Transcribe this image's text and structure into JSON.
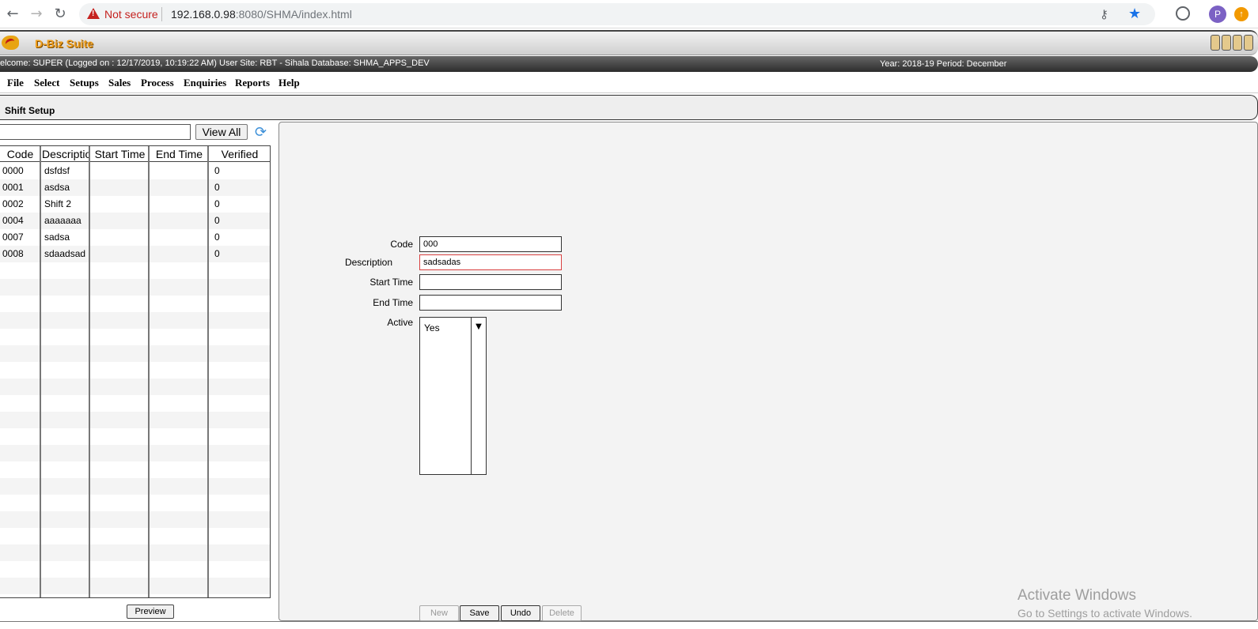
{
  "browser": {
    "security_label": "Not secure",
    "url_host": "192.168.0.98",
    "url_rest": ":8080/SHMA/index.html",
    "profile_initial": "P"
  },
  "app": {
    "logo_text": "D-Biz Suite",
    "welcome_text": "elcome: SUPER (Logged on : 12/17/2019, 10:19:22 AM) User Site: RBT - Sihala Database: SHMA_APPS_DEV",
    "period_text": "Year: 2018-19 Period: December"
  },
  "menu": [
    "File",
    "Select",
    "Setups",
    "Sales",
    "Process",
    "Enquiries",
    "Reports",
    "Help"
  ],
  "page": {
    "title": "Shift Setup"
  },
  "list": {
    "search_value": "",
    "view_all_label": "View All",
    "columns": [
      "Code",
      "Descriptio",
      "Start Time",
      "End Time",
      "Verified"
    ],
    "rows": [
      {
        "code": "0000",
        "description": "dsfdsf",
        "start_time": "",
        "end_time": "",
        "verified": "0"
      },
      {
        "code": "0001",
        "description": "asdsa",
        "start_time": "",
        "end_time": "",
        "verified": "0"
      },
      {
        "code": "0002",
        "description": "Shift 2",
        "start_time": "",
        "end_time": "",
        "verified": "0"
      },
      {
        "code": "0004",
        "description": "aaaaaaa",
        "start_time": "",
        "end_time": "",
        "verified": "0"
      },
      {
        "code": "0007",
        "description": "sadsa",
        "start_time": "",
        "end_time": "",
        "verified": "0"
      },
      {
        "code": "0008",
        "description": "sdaadsad",
        "start_time": "",
        "end_time": "",
        "verified": "0"
      }
    ],
    "preview_label": "Preview"
  },
  "form": {
    "code_label": "Code",
    "code_value": "000",
    "description_label": "Description",
    "description_value": "sadsadas",
    "start_time_label": "Start Time",
    "start_time_value": "",
    "end_time_label": "End Time",
    "end_time_value": "",
    "active_label": "Active",
    "active_value": "Yes"
  },
  "actions": {
    "new": "New",
    "save": "Save",
    "undo": "Undo",
    "delete": "Delete"
  },
  "watermark": {
    "line1": "Activate Windows",
    "line2": "Go to Settings to activate Windows."
  }
}
